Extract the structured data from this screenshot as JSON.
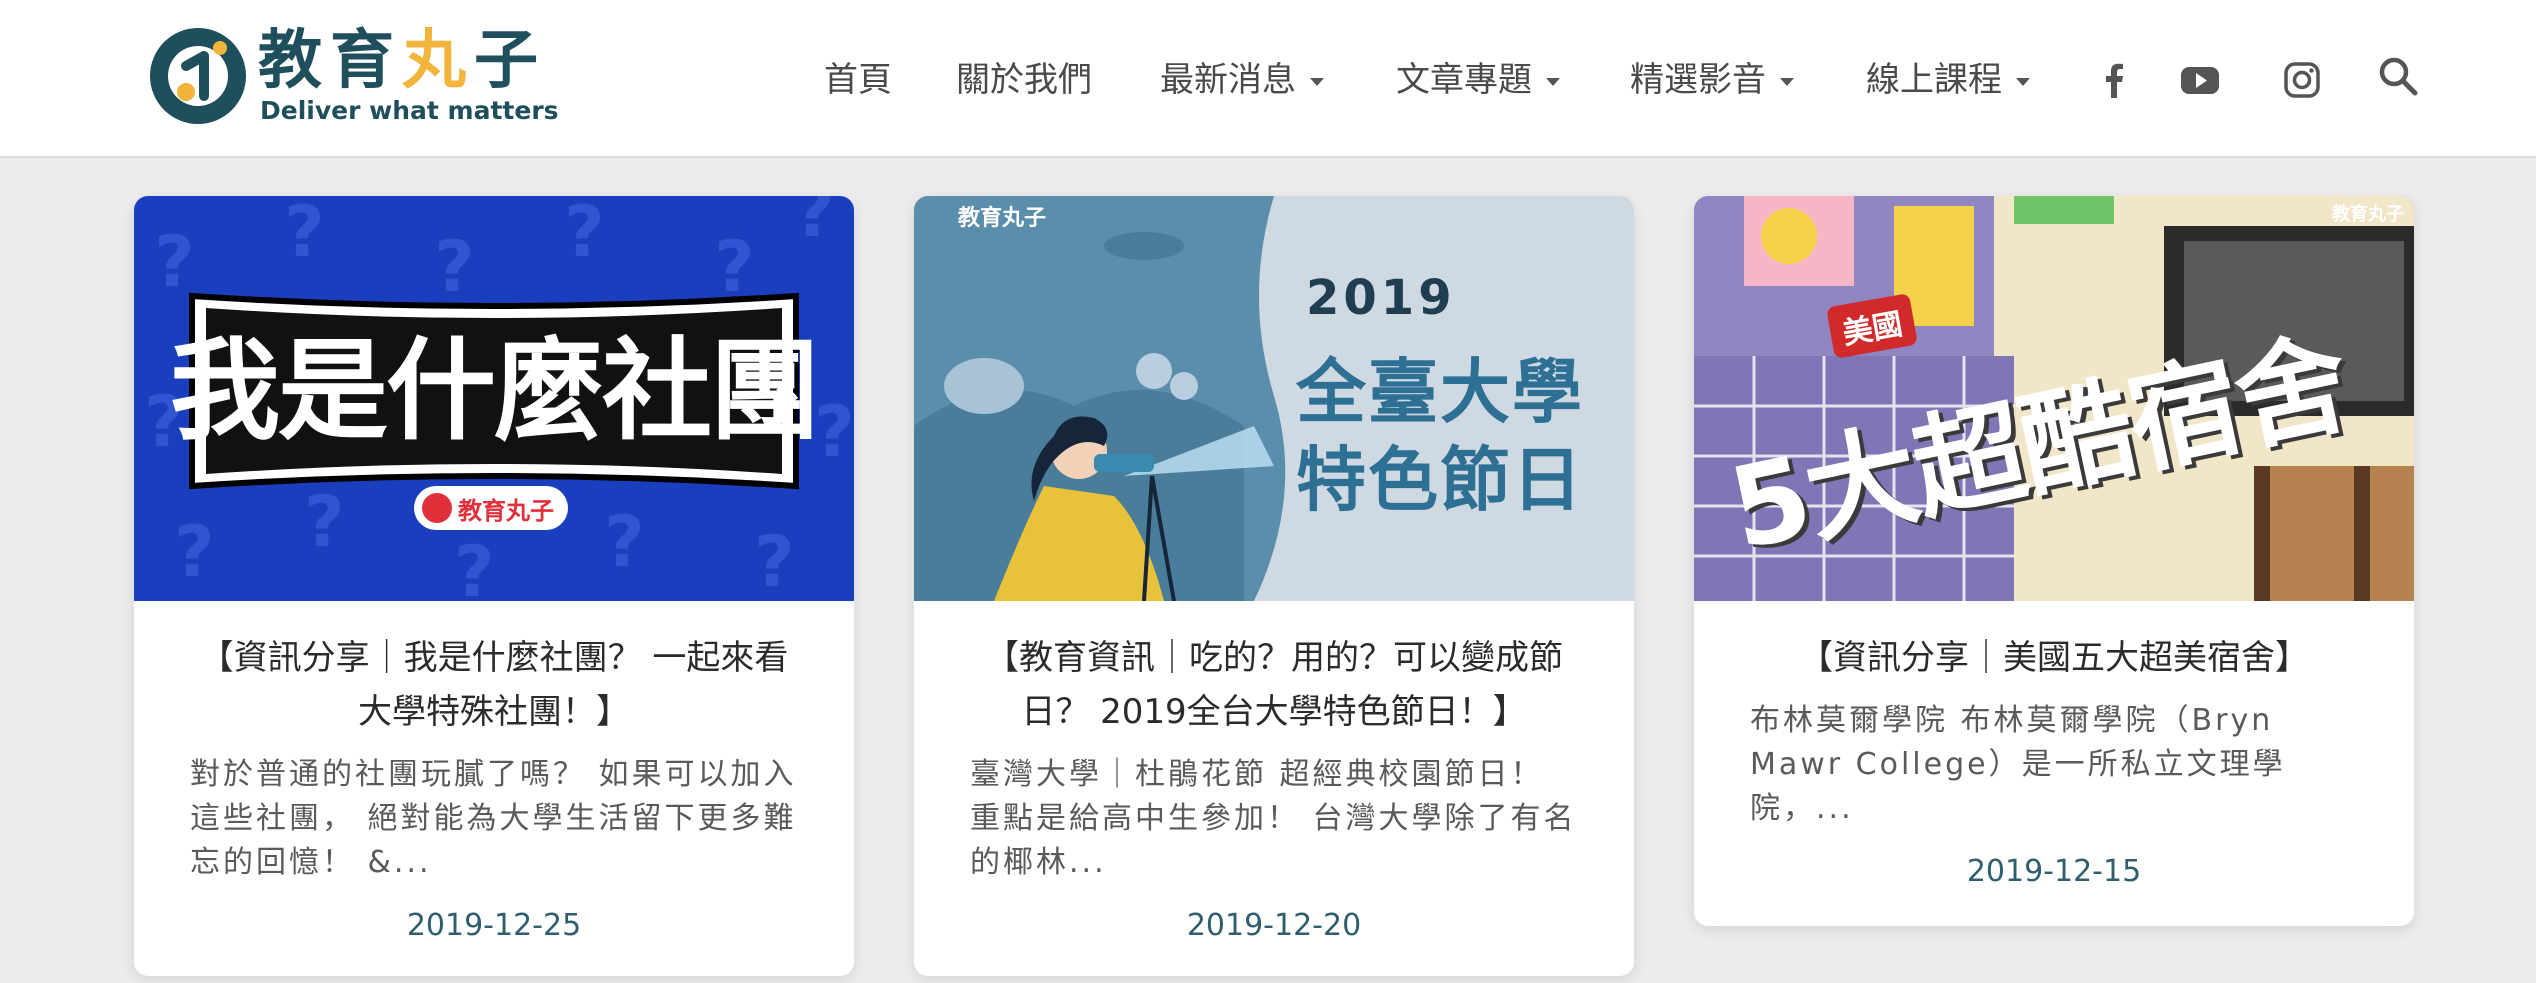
{
  "header": {
    "logo": {
      "title_main": "教育",
      "title_accent": "丸",
      "title_end": "子",
      "tagline": "Deliver what matters"
    },
    "nav": [
      {
        "label": "首頁",
        "dropdown": false
      },
      {
        "label": "關於我們",
        "dropdown": false
      },
      {
        "label": "最新消息",
        "dropdown": true
      },
      {
        "label": "文章專題",
        "dropdown": true
      },
      {
        "label": "精選影音",
        "dropdown": true
      },
      {
        "label": "線上課程",
        "dropdown": true
      }
    ],
    "social_icons": [
      "facebook-icon",
      "youtube-icon",
      "instagram-icon",
      "search-icon"
    ]
  },
  "cards": [
    {
      "image_text": "我是什麼社團",
      "image_brand": "教育丸子",
      "title": "【資訊分享｜我是什麼社團？ 一起來看大學特殊社團！】",
      "excerpt": "對於普通的社團玩膩了嗎？ 如果可以加入這些社團， 絕對能為大學生活留下更多難忘的回憶！ &...",
      "date": "2019-12-25"
    },
    {
      "image_brand": "教育丸子",
      "image_year": "2019",
      "image_line1": "全臺大學",
      "image_line2": "特色節日",
      "title": "【教育資訊｜吃的？用的？可以變成節日？ 2019全台大學特色節日！】",
      "excerpt": "臺灣大學｜杜鵑花節 超經典校園節日！ 重點是給高中生參加！ 台灣大學除了有名的椰林...",
      "date": "2019-12-20"
    },
    {
      "image_brand": "教育丸子",
      "image_badge": "美國",
      "image_text": "5大超酷宿舍",
      "title": "【資訊分享｜美國五大超美宿舍】",
      "excerpt": "布林莫爾學院 布林莫爾學院（Bryn Mawr College）是一所私立文理學院，...",
      "date": "2019-12-15"
    }
  ],
  "colors": {
    "brand_dark": "#1f4e5c",
    "brand_accent": "#f2b43a",
    "card1_bg": "#1a3fbe",
    "card2_bg": "#5b8eab",
    "card3_bg": "#8f86c2"
  }
}
